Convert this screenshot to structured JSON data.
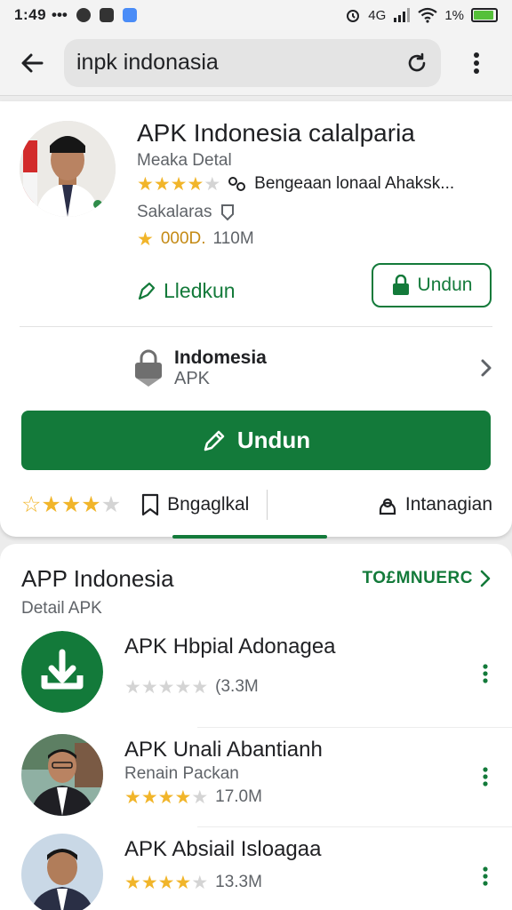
{
  "status": {
    "time": "1:49",
    "dots": "•••",
    "network": "4G",
    "battery": "1%",
    "battery_level": 0.9
  },
  "search": {
    "query": "inpk indonasia"
  },
  "app": {
    "title": "APK Indonesia calalparia",
    "subtitle": "Meaka Detal",
    "rating_stars": 4,
    "tagline": "Bengeaan lonaal Ahaksk...",
    "developer": "Sakalaras",
    "downloads_code": "000D.",
    "downloads_size": "110M",
    "wishlist_label": "Lledkun",
    "install_small_label": "Undun",
    "info_title": "Indomesia",
    "info_sub": "APK",
    "install_big_label": "Undun",
    "user_rating_stars": 3,
    "bookmark_label": "Bngaglkal",
    "share_label": "Intanagian"
  },
  "section": {
    "title": "APP Indonesia",
    "subtitle": "Detail APK",
    "see_more": "TO£MNUERC"
  },
  "items": [
    {
      "title": "APK Hbpial Adonagea",
      "sub": "",
      "stars": 0,
      "size": "(3.3M"
    },
    {
      "title": "APK Unali Abantianh",
      "sub": "Renain Packan",
      "stars": 4,
      "size": "17.0M"
    },
    {
      "title": "APK Absiail Isloagaa",
      "sub": "",
      "stars": 4,
      "size": "13.3M"
    }
  ],
  "colors": {
    "accent": "#137a3a",
    "star": "#f1b52a"
  },
  "icons": [
    "arrow-back-icon",
    "refresh-icon",
    "more-vert-icon",
    "pencil-icon",
    "lock-icon",
    "chevron-right-icon",
    "bookmark-icon",
    "share-icon",
    "download-icon"
  ]
}
